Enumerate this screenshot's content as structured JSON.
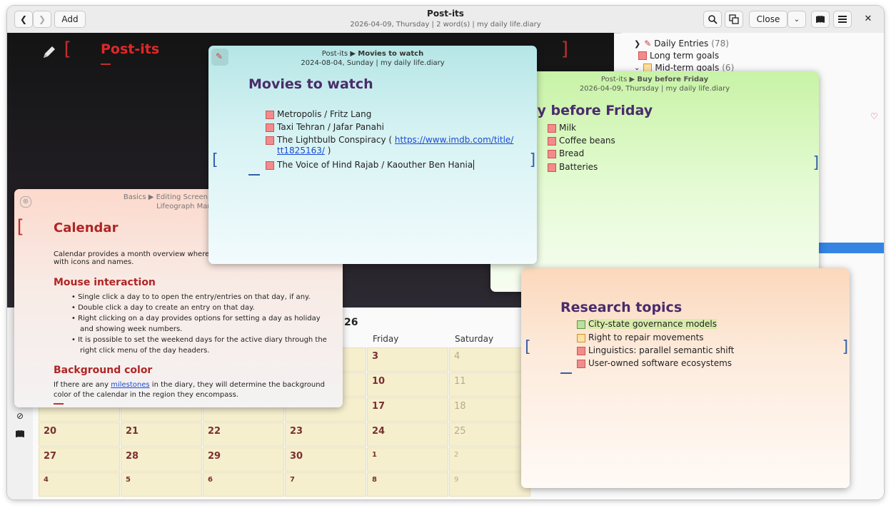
{
  "titlebar": {
    "title": "Post-its",
    "subtitle": "2026-04-09, Thursday  |  2 word(s)  |  my daily life.diary",
    "add_label": "Add",
    "close_label": "Close"
  },
  "editor": {
    "heading": "Post-its"
  },
  "tree": {
    "items": [
      {
        "label": "Daily Entries",
        "count": "(78)"
      },
      {
        "label": "Long term goals",
        "count": ""
      },
      {
        "label": "Mid-term goals",
        "count": "(6)"
      }
    ]
  },
  "notes": {
    "movies": {
      "path": "Post-its ▶",
      "path_title": "Movies to watch",
      "meta": "2024-08-04, Sunday  |  my daily life.diary",
      "title": "Movies to watch",
      "items": [
        "Metropolis / Fritz Lang",
        "Taxi Tehran / Jafar Panahi",
        "The Lightbulb Conspiracy (",
        "The Voice of Hind Rajab / Kaouther Ben Hania"
      ],
      "link_text_1": "https://www.imdb.com/title/",
      "link_text_2": "tt1825163/",
      "link_tail": " )"
    },
    "buy": {
      "path": "Post-its ▶",
      "path_title": "Buy before Friday",
      "meta": "2026-04-09, Thursday  |  my daily life.diary",
      "title": "uy before Friday",
      "items": [
        "Milk",
        "Coffee beans",
        "Bread",
        "Batteries"
      ]
    },
    "manual": {
      "path_line1": "Basics ▶ Editing Screen ▶ C",
      "path_line2": "Lifeograph Manual",
      "title": "Calendar",
      "intro_1": "Calendar provides a month overview where e",
      "intro_2": "with icons and names.",
      "h_mouse": "Mouse interaction",
      "bullets": [
        "Single click a day to to open the entry/entries on that day, if any.",
        "Double click a day to create an entry on that day.",
        "Right clicking on a day provides options for setting a day as holiday",
        "and showing week numbers.",
        "It is possible to set the weekend days for the active diary through the",
        "right click menu of the day headers."
      ],
      "h_bg": "Background color",
      "bg_1": "If there are any ",
      "bg_link": "milestones",
      "bg_2": " in the diary, they will determine the background",
      "bg_3": "color of the calendar in the region they encompass."
    },
    "research": {
      "title": "Research topics",
      "items": [
        "City-state governance models",
        "Right to repair movements",
        "Linguistics: parallel semantic shift",
        "User-owned software ecosystems"
      ]
    }
  },
  "calendar": {
    "year_fragment": "26",
    "headers": [
      "Friday",
      "Saturday"
    ],
    "rows": [
      [
        "",
        "",
        "",
        "",
        "3",
        "4"
      ],
      [
        "",
        "",
        "",
        "",
        "10",
        "11"
      ],
      [
        "",
        "",
        "",
        "",
        "17",
        "18"
      ],
      [
        "20",
        "21",
        "22",
        "23",
        "24",
        "25"
      ],
      [
        "27",
        "28",
        "29",
        "30",
        "1",
        "2"
      ],
      [
        "4",
        "5",
        "6",
        "7",
        "8",
        "9"
      ]
    ]
  }
}
